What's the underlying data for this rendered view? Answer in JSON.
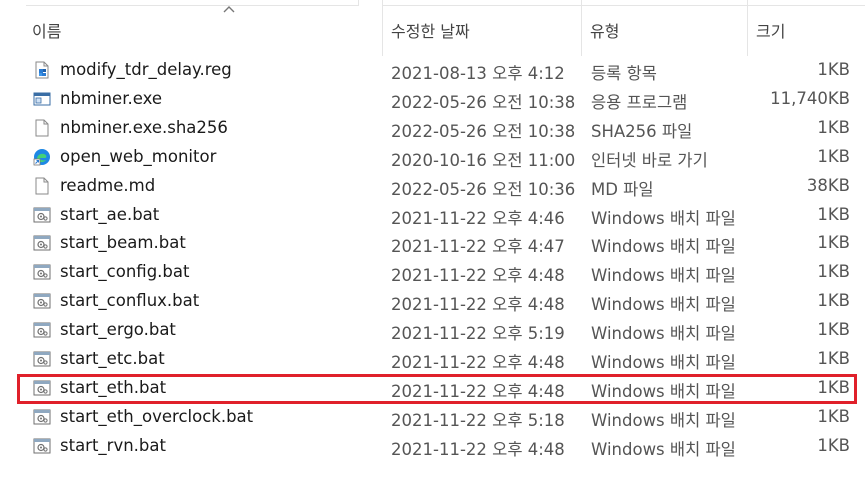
{
  "header": {
    "name_label": "이름",
    "date_label": "수정한 날짜",
    "type_label": "유형",
    "size_label": "크기"
  },
  "files": [
    {
      "name": "modify_tdr_delay.reg",
      "date": "2021-08-13 오후 4:12",
      "type": "등록 항목",
      "size": "1KB",
      "icon": "registry-file-icon"
    },
    {
      "name": "nbminer.exe",
      "date": "2022-05-26 오전 10:38",
      "type": "응용 프로그램",
      "size": "11,740KB",
      "icon": "application-icon"
    },
    {
      "name": "nbminer.exe.sha256",
      "date": "2022-05-26 오전 10:38",
      "type": "SHA256 파일",
      "size": "1KB",
      "icon": "blank-file-icon"
    },
    {
      "name": "open_web_monitor",
      "date": "2020-10-16 오전 11:00",
      "type": "인터넷 바로 가기",
      "size": "1KB",
      "icon": "edge-shortcut-icon"
    },
    {
      "name": "readme.md",
      "date": "2022-05-26 오전 10:36",
      "type": "MD 파일",
      "size": "38KB",
      "icon": "blank-file-icon"
    },
    {
      "name": "start_ae.bat",
      "date": "2021-11-22 오후 4:46",
      "type": "Windows 배치 파일",
      "size": "1KB",
      "icon": "batch-file-icon"
    },
    {
      "name": "start_beam.bat",
      "date": "2021-11-22 오후 4:47",
      "type": "Windows 배치 파일",
      "size": "1KB",
      "icon": "batch-file-icon"
    },
    {
      "name": "start_config.bat",
      "date": "2021-11-22 오후 4:48",
      "type": "Windows 배치 파일",
      "size": "1KB",
      "icon": "batch-file-icon"
    },
    {
      "name": "start_conflux.bat",
      "date": "2021-11-22 오후 4:48",
      "type": "Windows 배치 파일",
      "size": "1KB",
      "icon": "batch-file-icon"
    },
    {
      "name": "start_ergo.bat",
      "date": "2021-11-22 오후 5:19",
      "type": "Windows 배치 파일",
      "size": "1KB",
      "icon": "batch-file-icon"
    },
    {
      "name": "start_etc.bat",
      "date": "2021-11-22 오후 4:48",
      "type": "Windows 배치 파일",
      "size": "1KB",
      "icon": "batch-file-icon"
    },
    {
      "name": "start_eth.bat",
      "date": "2021-11-22 오후 4:48",
      "type": "Windows 배치 파일",
      "size": "1KB",
      "icon": "batch-file-icon"
    },
    {
      "name": "start_eth_overclock.bat",
      "date": "2021-11-22 오후 5:18",
      "type": "Windows 배치 파일",
      "size": "1KB",
      "icon": "batch-file-icon"
    },
    {
      "name": "start_rvn.bat",
      "date": "2021-11-22 오후 4:48",
      "type": "Windows 배치 파일",
      "size": "1KB",
      "icon": "batch-file-icon"
    }
  ],
  "colors": {
    "highlight": "#e0202a",
    "header_text": "#444444",
    "secondary_text": "#555555"
  }
}
